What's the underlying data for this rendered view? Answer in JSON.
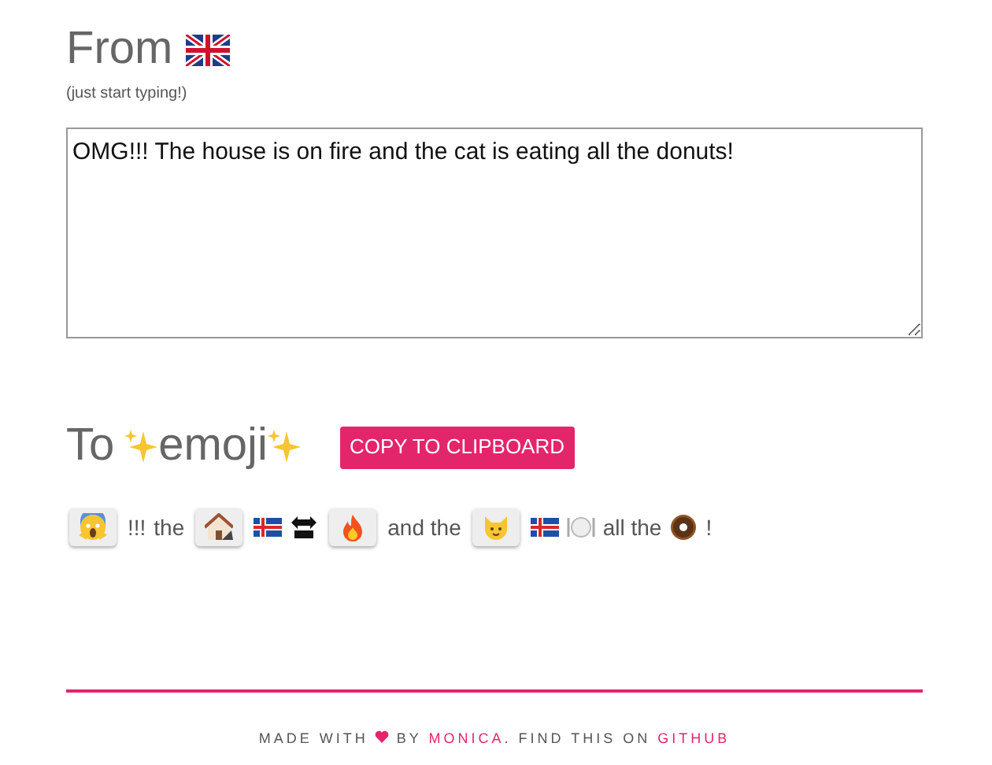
{
  "from": {
    "title": "From",
    "hint": "(just start typing!)"
  },
  "input": {
    "value": "OMG!!! The house is on fire and the cat is eating all the donuts!"
  },
  "to": {
    "title_before": "To",
    "title_word": "emoji",
    "button": "COPY TO CLIPBOARD"
  },
  "output": [
    {
      "kind": "chip"
    },
    {
      "kind": "text",
      "text": "!!!"
    },
    {
      "kind": "text",
      "text": "the"
    },
    {
      "kind": "chip"
    },
    {
      "kind": "icon"
    },
    {
      "kind": "icon"
    },
    {
      "kind": "chip"
    },
    {
      "kind": "text",
      "text": "and the"
    },
    {
      "kind": "chip"
    },
    {
      "kind": "icon"
    },
    {
      "kind": "icon"
    },
    {
      "kind": "text",
      "text": "all the"
    },
    {
      "kind": "icon"
    },
    {
      "kind": "text",
      "text": "!"
    }
  ],
  "footer": [
    {
      "kind": "text",
      "text": "MADE WITH"
    },
    {
      "kind": "heart"
    },
    {
      "kind": "text",
      "text": "BY"
    },
    {
      "kind": "link",
      "text": "MONICA"
    },
    {
      "kind": "text",
      "text": ". FIND THIS ON"
    },
    {
      "kind": "link",
      "text": "GITHUB"
    }
  ]
}
